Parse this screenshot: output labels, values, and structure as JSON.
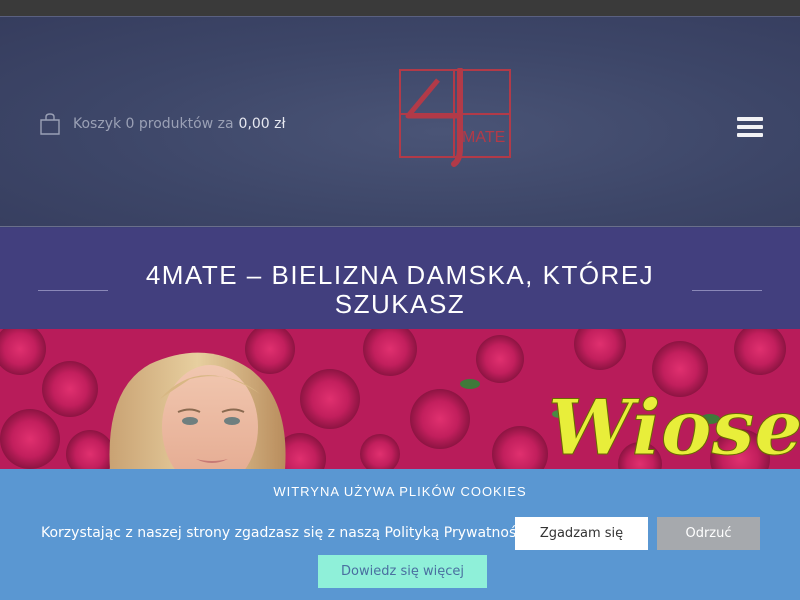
{
  "header": {
    "cart": {
      "text": "Koszyk 0 produktów za",
      "price": "0,00 zł",
      "icon": "shopping-bag-icon"
    },
    "logo": {
      "brand_text": "MATE",
      "numeral": "4"
    },
    "menu_icon": "hamburger-menu-icon"
  },
  "page": {
    "title": "4MATE – BIELIZNA DAMSKA, KTÓREJ SZUKASZ"
  },
  "hero": {
    "banner_text": "Wiosen"
  },
  "cookie_notice": {
    "title": "WITRYNA UŻYWA PLIKÓW COOKIES",
    "text": "Korzystając z naszej strony zgadzasz się z naszą Polityką Prywatności.",
    "accept_label": "Zgadzam się",
    "reject_label": "Odrzuć",
    "more_label": "Dowiedz się więcej"
  },
  "colors": {
    "topbar": "#3a3a3a",
    "header_bg": "#3d4668",
    "title_band": "#423f7e",
    "cookie_bg": "#5a97d2",
    "accept_bg": "#ffffff",
    "reject_bg": "#a6a9ad",
    "more_bg": "#8ff0d9",
    "logo_red": "#b23a48"
  }
}
